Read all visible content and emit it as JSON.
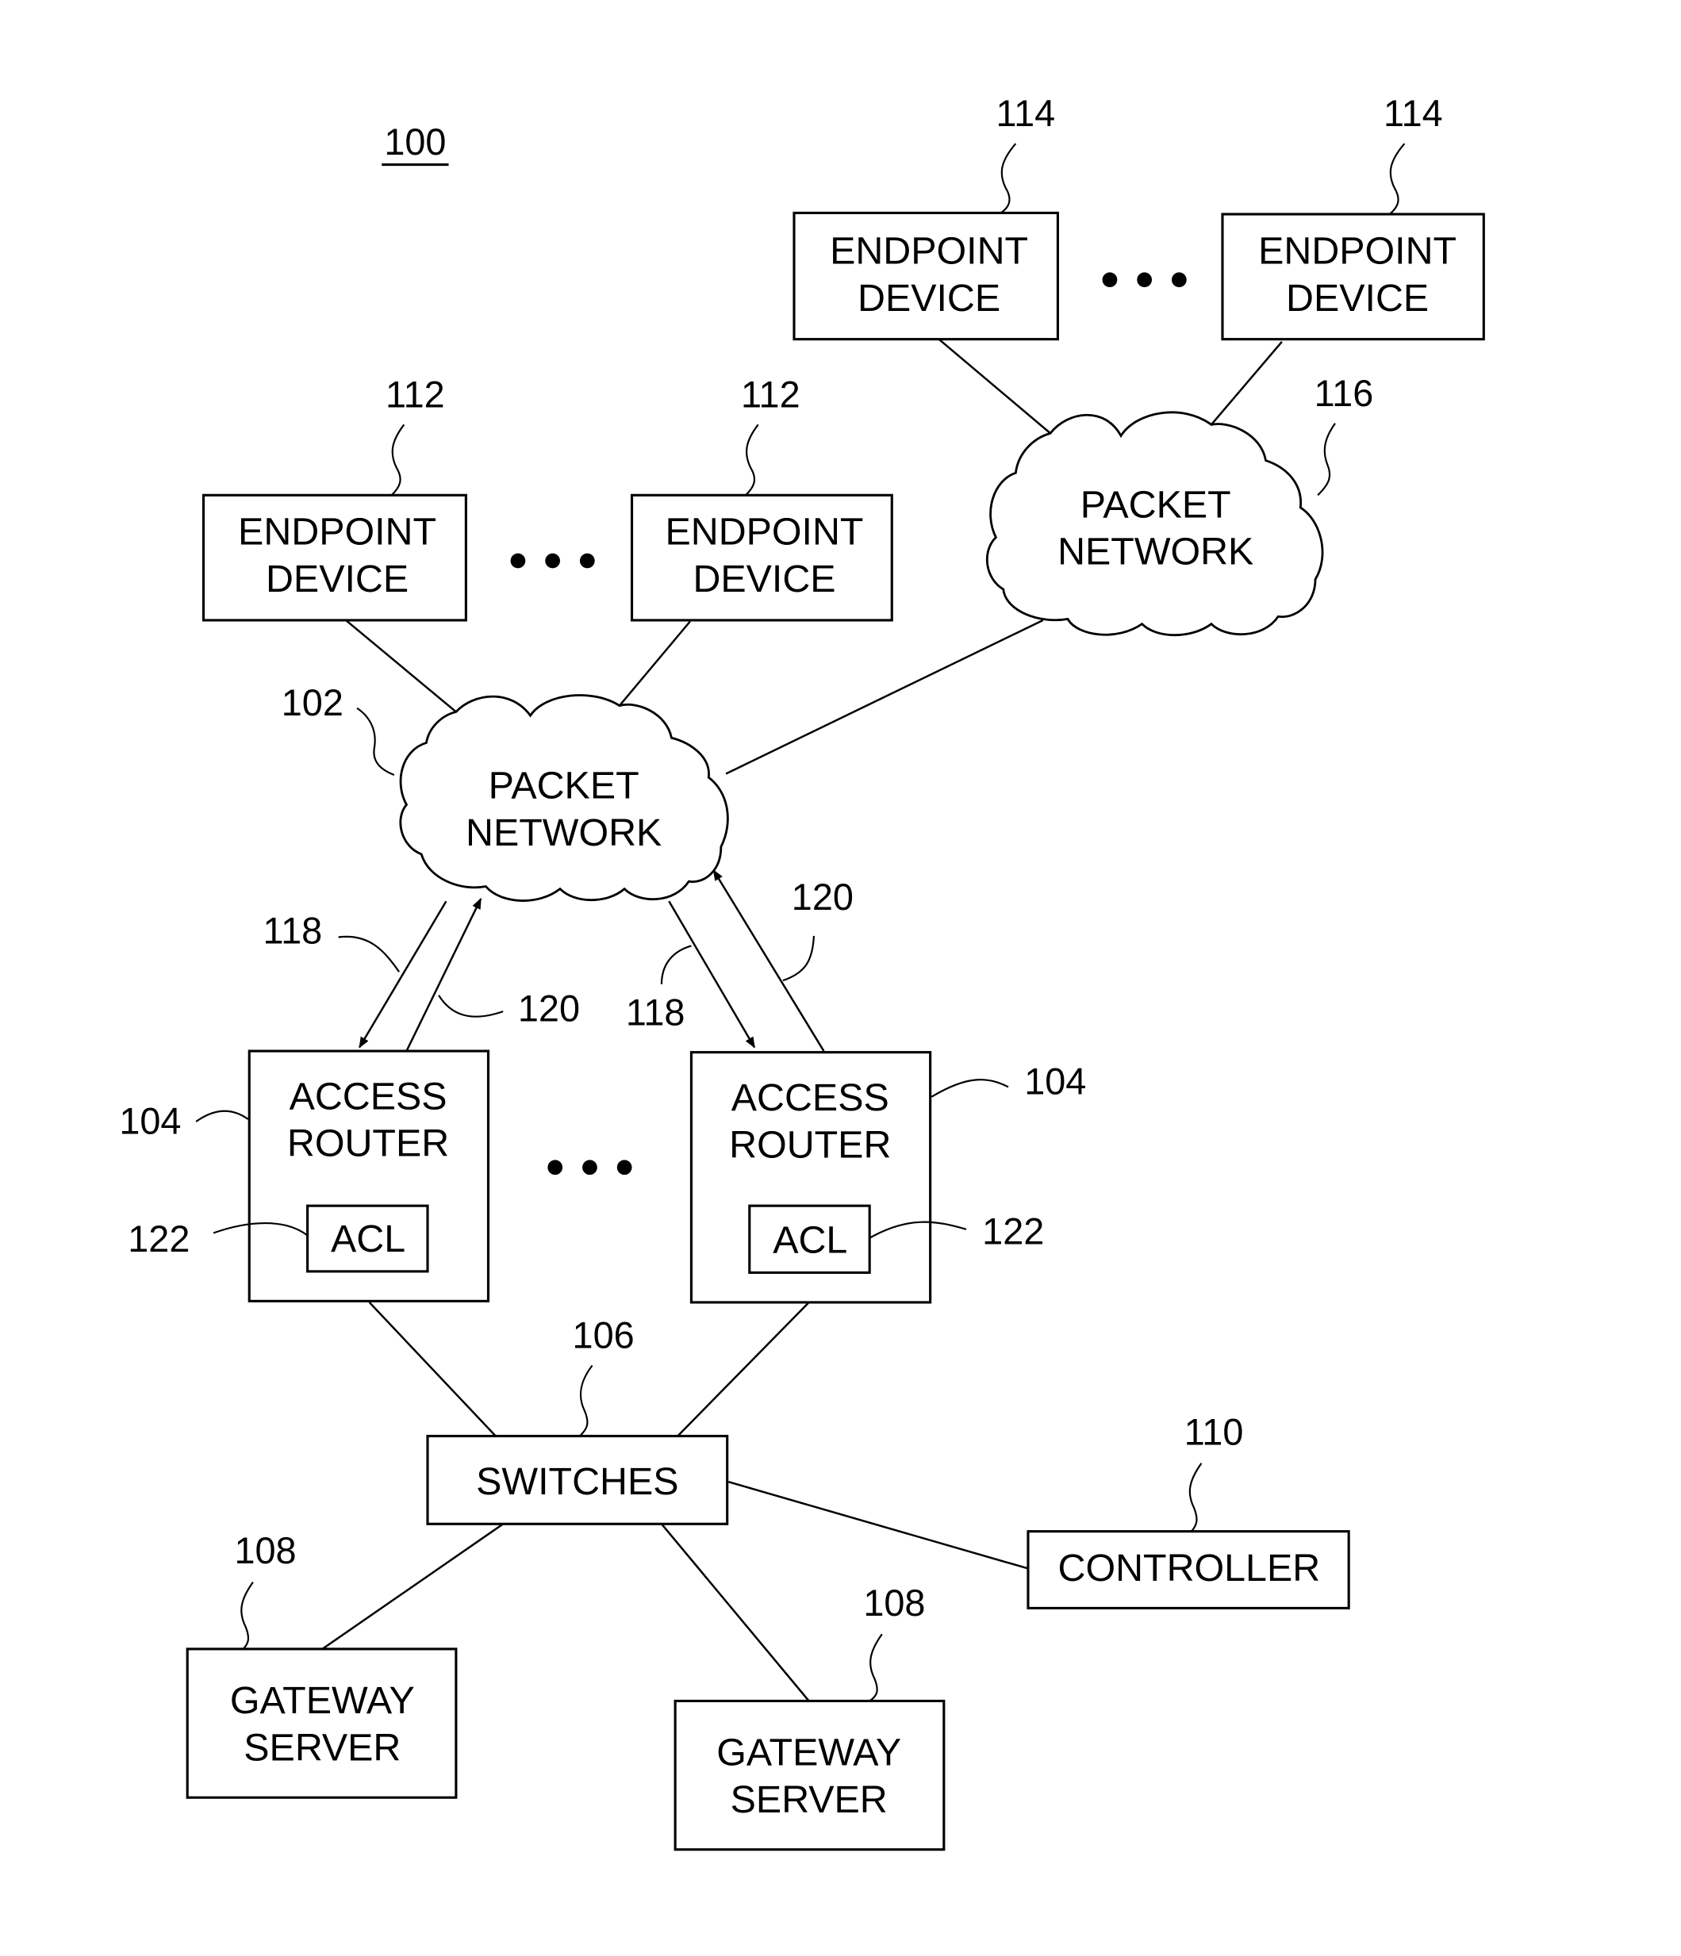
{
  "figure": {
    "ref": "100",
    "colors": {
      "ink": "#000000",
      "background": "#ffffff"
    }
  },
  "nodes": {
    "endpoint_114_a": {
      "line1": "ENDPOINT",
      "line2": "DEVICE",
      "ref": "114"
    },
    "endpoint_114_b": {
      "line1": "ENDPOINT",
      "line2": "DEVICE",
      "ref": "114"
    },
    "endpoint_112_a": {
      "line1": "ENDPOINT",
      "line2": "DEVICE",
      "ref": "112"
    },
    "endpoint_112_b": {
      "line1": "ENDPOINT",
      "line2": "DEVICE",
      "ref": "112"
    },
    "packet_network_116": {
      "line1": "PACKET",
      "line2": "NETWORK",
      "ref": "116"
    },
    "packet_network_102": {
      "line1": "PACKET",
      "line2": "NETWORK",
      "ref": "102"
    },
    "access_router_left": {
      "line1": "ACCESS",
      "line2": "ROUTER",
      "ref": "104",
      "acl": "ACL",
      "acl_ref": "122"
    },
    "access_router_right": {
      "line1": "ACCESS",
      "line2": "ROUTER",
      "ref": "104",
      "acl": "ACL",
      "acl_ref": "122"
    },
    "switches": {
      "label": "SWITCHES",
      "ref": "106"
    },
    "controller": {
      "label": "CONTROLLER",
      "ref": "110"
    },
    "gateway_left": {
      "line1": "GATEWAY",
      "line2": "SERVER",
      "ref": "108"
    },
    "gateway_right": {
      "line1": "GATEWAY",
      "line2": "SERVER",
      "ref": "108"
    }
  },
  "links": {
    "downstream_ref": "118",
    "upstream_ref": "120"
  },
  "ellipsis": "• • •"
}
